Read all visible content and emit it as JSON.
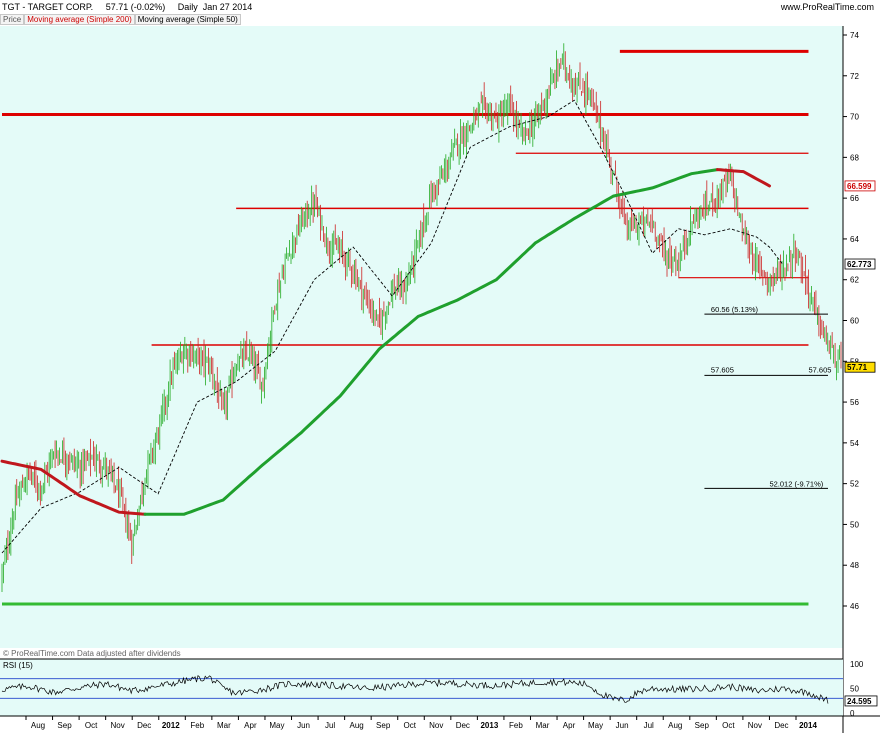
{
  "header": {
    "symbol": "TGT - TARGET CORP.",
    "last": "57.71 (-0.02%)",
    "period": "Daily  Jan 27 2014",
    "site": "www.ProRealTime.com"
  },
  "indicators": {
    "price_tab": "Price",
    "ma200_tab": "Moving average (Simple 200)",
    "ma50_tab": "Moving average (Simple 50)"
  },
  "colors": {
    "background": "#e4fbf8",
    "up": "#22aa22",
    "down": "#cc2222",
    "ma200_up": "#1fa02d",
    "ma200_down": "#c0171d",
    "hline_red": "#dd0000",
    "hline_green": "#33bb33",
    "ma50": "#000000"
  },
  "footer": {
    "copyright": "© ProRealTime.com Data adjusted after dividends"
  },
  "chart_data": [
    {
      "type": "candlestick",
      "title": "TGT - TARGET CORP.",
      "ylim": [
        45,
        75
      ],
      "yticks": [
        "74",
        "72",
        "70",
        "68",
        "66",
        "64",
        "62",
        "60",
        "58",
        "56",
        "54",
        "52",
        "50",
        "48",
        "46"
      ],
      "xticks": [
        "Aug",
        "Sep",
        "Oct",
        "Nov",
        "Dec",
        "2012",
        "Feb",
        "Mar",
        "Apr",
        "May",
        "Jun",
        "Jul",
        "Aug",
        "Sep",
        "Oct",
        "Nov",
        "Dec",
        "2013",
        "Feb",
        "Mar",
        "Apr",
        "May",
        "Jun",
        "Jul",
        "Aug",
        "Sep",
        "Oct",
        "Nov",
        "Dec",
        "2014"
      ],
      "price_keypoints": [
        [
          0,
          47.5
        ],
        [
          2,
          51.0
        ],
        [
          4,
          52.5
        ],
        [
          6,
          51.8
        ],
        [
          8,
          53.6
        ],
        [
          10,
          53.3
        ],
        [
          12,
          52.8
        ],
        [
          14,
          53.3
        ],
        [
          16,
          52.8
        ],
        [
          18,
          51.5
        ],
        [
          20,
          49.0
        ],
        [
          22,
          52.5
        ],
        [
          24,
          54.5
        ],
        [
          26,
          57.3
        ],
        [
          28,
          58.6
        ],
        [
          30,
          58.2
        ],
        [
          32,
          57.8
        ],
        [
          34,
          55.5
        ],
        [
          36,
          57.9
        ],
        [
          38,
          58.4
        ],
        [
          40,
          56.8
        ],
        [
          42,
          61.0
        ],
        [
          44,
          63.3
        ],
        [
          46,
          64.8
        ],
        [
          48,
          65.8
        ],
        [
          50,
          63.8
        ],
        [
          52,
          63.4
        ],
        [
          54,
          62.5
        ],
        [
          56,
          61.0
        ],
        [
          58,
          59.8
        ],
        [
          60,
          61.5
        ],
        [
          62,
          61.6
        ],
        [
          64,
          63.8
        ],
        [
          66,
          66.2
        ],
        [
          68,
          67.2
        ],
        [
          70,
          68.8
        ],
        [
          72,
          69.5
        ],
        [
          74,
          70.5
        ],
        [
          76,
          69.8
        ],
        [
          78,
          70.5
        ],
        [
          80,
          69.0
        ],
        [
          82,
          69.8
        ],
        [
          84,
          71.2
        ],
        [
          86,
          72.8
        ],
        [
          88,
          71.5
        ],
        [
          90,
          71.3
        ],
        [
          92,
          69.5
        ],
        [
          94,
          67.2
        ],
        [
          96,
          64.5
        ],
        [
          98,
          64.7
        ],
        [
          100,
          64.8
        ],
        [
          102,
          63.2
        ],
        [
          104,
          62.8
        ],
        [
          106,
          64.8
        ],
        [
          108,
          65.5
        ],
        [
          110,
          66.2
        ],
        [
          112,
          67.0
        ],
        [
          114,
          64.2
        ],
        [
          116,
          62.7
        ],
        [
          118,
          62.0
        ],
        [
          120,
          62.5
        ],
        [
          122,
          63.5
        ],
        [
          124,
          61.5
        ],
        [
          126,
          59.5
        ],
        [
          128,
          58.2
        ],
        [
          129,
          57.71
        ]
      ],
      "ma50": [
        [
          0,
          48.6
        ],
        [
          6,
          50.8
        ],
        [
          12,
          51.6
        ],
        [
          18,
          52.8
        ],
        [
          24,
          51.5
        ],
        [
          30,
          56.0
        ],
        [
          36,
          57.0
        ],
        [
          42,
          58.5
        ],
        [
          48,
          62.0
        ],
        [
          54,
          63.6
        ],
        [
          60,
          61.2
        ],
        [
          66,
          63.8
        ],
        [
          72,
          68.5
        ],
        [
          78,
          69.5
        ],
        [
          84,
          70.0
        ],
        [
          88,
          70.8
        ],
        [
          92,
          68.5
        ],
        [
          96,
          66.0
        ],
        [
          100,
          63.3
        ],
        [
          104,
          64.5
        ],
        [
          108,
          64.2
        ],
        [
          112,
          64.5
        ],
        [
          116,
          64.1
        ],
        [
          118,
          63.6
        ],
        [
          120,
          62.77
        ]
      ],
      "ma200": [
        [
          0,
          53.1
        ],
        [
          6,
          52.7
        ],
        [
          12,
          51.4
        ],
        [
          18,
          50.6
        ],
        [
          22,
          50.5
        ],
        [
          28,
          50.5
        ],
        [
          34,
          51.2
        ],
        [
          40,
          52.9
        ],
        [
          46,
          54.5
        ],
        [
          52,
          56.3
        ],
        [
          58,
          58.6
        ],
        [
          64,
          60.2
        ],
        [
          70,
          61.0
        ],
        [
          76,
          62.0
        ],
        [
          82,
          63.8
        ],
        [
          88,
          65.0
        ],
        [
          94,
          66.1
        ],
        [
          100,
          66.5
        ],
        [
          106,
          67.2
        ],
        [
          110,
          67.4
        ],
        [
          114,
          67.3
        ],
        [
          118,
          66.6
        ]
      ],
      "ma200_turn_index": 110,
      "horizontal_lines": [
        {
          "y": 73.2,
          "color": "red",
          "x_from": 95,
          "x_to": 124
        },
        {
          "y": 70.1,
          "color": "red",
          "x_from": 0,
          "x_to": 124
        },
        {
          "y": 65.5,
          "color": "red",
          "x_from": 36,
          "x_to": 124
        },
        {
          "y": 68.2,
          "color": "red",
          "x_from": 79,
          "x_to": 124
        },
        {
          "y": 62.1,
          "color": "red",
          "x_from": 104,
          "x_to": 124
        },
        {
          "y": 58.8,
          "color": "red",
          "x_from": 23,
          "x_to": 124
        },
        {
          "y": 46.1,
          "color": "green",
          "x_from": 0,
          "x_to": 124
        }
      ],
      "fib_levels": [
        {
          "y": 60.56,
          "label": "60.56 (5.13%)"
        },
        {
          "y": 57.605,
          "label_left": "57.605",
          "label_right": "57.605"
        },
        {
          "y": 52.012,
          "label": "52.012 (-9.71%)"
        }
      ],
      "price_labels": [
        {
          "value": "66.599",
          "y": 66.6,
          "style": "red"
        },
        {
          "value": "62.773",
          "y": 62.77,
          "style": "black"
        },
        {
          "value": "57.71",
          "y": 57.71,
          "style": "last"
        }
      ],
      "last_price": 57.71
    },
    {
      "type": "line",
      "title": "RSI (15)",
      "ylim": [
        0,
        100
      ],
      "yticks": [
        "100",
        "50",
        "0"
      ],
      "overbought": 70,
      "oversold": 30,
      "last_label": "24.595",
      "rsi_keypoints": [
        [
          0,
          48
        ],
        [
          4,
          55
        ],
        [
          8,
          42
        ],
        [
          12,
          52
        ],
        [
          16,
          60
        ],
        [
          20,
          45
        ],
        [
          24,
          55
        ],
        [
          28,
          65
        ],
        [
          30,
          70
        ],
        [
          32,
          72
        ],
        [
          34,
          50
        ],
        [
          36,
          40
        ],
        [
          40,
          48
        ],
        [
          44,
          60
        ],
        [
          48,
          58
        ],
        [
          52,
          55
        ],
        [
          56,
          50
        ],
        [
          60,
          54
        ],
        [
          64,
          60
        ],
        [
          68,
          62
        ],
        [
          72,
          58
        ],
        [
          76,
          56
        ],
        [
          80,
          60
        ],
        [
          84,
          64
        ],
        [
          88,
          62
        ],
        [
          90,
          58
        ],
        [
          92,
          40
        ],
        [
          94,
          28
        ],
        [
          96,
          26
        ],
        [
          98,
          44
        ],
        [
          100,
          50
        ],
        [
          104,
          48
        ],
        [
          108,
          50
        ],
        [
          112,
          54
        ],
        [
          116,
          45
        ],
        [
          120,
          50
        ],
        [
          124,
          42
        ],
        [
          127,
          24.6
        ]
      ]
    }
  ]
}
